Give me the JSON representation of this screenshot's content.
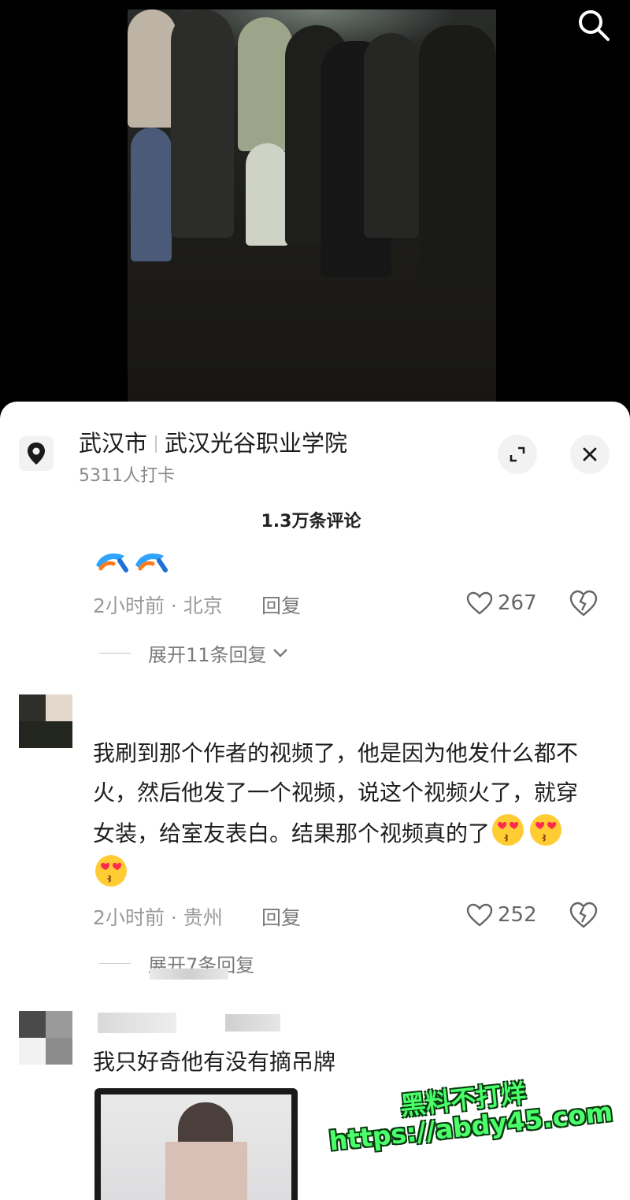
{
  "video": {
    "search_icon": "search-icon"
  },
  "location": {
    "city": "武汉市",
    "place": "武汉光谷职业学院",
    "checkins": "5311人打卡",
    "pin_icon": "location-pin-icon",
    "expand_icon": "expand-icon",
    "close_icon": "close-icon"
  },
  "comments_count": "1.3万条评论",
  "comments": [
    {
      "body_icons": [
        "kick-emoji",
        "kick-emoji"
      ],
      "time_loc": "2小时前 · 北京",
      "reply": "回复",
      "likes": "267",
      "expand": "展开11条回复"
    },
    {
      "text": "我刷到那个作者的视频了，他是因为他发什么都不火，然后他发了一个视频，说这个视频火了，就穿女装，给室友表白。结果那个视频真的了",
      "emojis": [
        "heart-eyes-kiss-emoji",
        "heart-eyes-kiss-emoji",
        "heart-eyes-kiss-emoji"
      ],
      "time_loc": "2小时前 · 贵州",
      "reply": "回复",
      "likes": "252",
      "expand": "展开7条回复"
    },
    {
      "text": "我只好奇他有没有摘吊牌"
    }
  ],
  "watermark": {
    "line1": "黑料不打烊",
    "line2": "https://abdy45.com"
  },
  "colors": {
    "sheet_bg": "#ffffff",
    "text_main": "#1e1e1e",
    "text_meta": "#9a9a9a",
    "watermark": "#4aff6a"
  }
}
